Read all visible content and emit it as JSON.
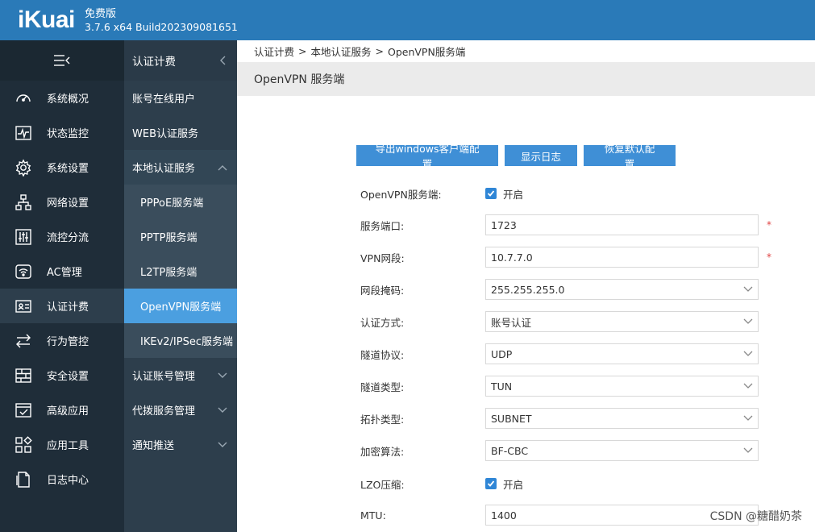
{
  "header": {
    "logo": "iKuai",
    "edition": "免费版",
    "build": "3.7.6 x64 Build202309081651"
  },
  "nav1": {
    "items": [
      {
        "label": "系统概况",
        "icon": "gauge-icon"
      },
      {
        "label": "状态监控",
        "icon": "monitor-icon"
      },
      {
        "label": "系统设置",
        "icon": "gear-icon"
      },
      {
        "label": "网络设置",
        "icon": "network-icon"
      },
      {
        "label": "流控分流",
        "icon": "sliders-icon"
      },
      {
        "label": "AC管理",
        "icon": "wifi-icon"
      },
      {
        "label": "认证计费",
        "icon": "id-card-icon"
      },
      {
        "label": "行为管控",
        "icon": "arrows-icon"
      },
      {
        "label": "安全设置",
        "icon": "firewall-icon"
      },
      {
        "label": "高级应用",
        "icon": "check-window-icon"
      },
      {
        "label": "应用工具",
        "icon": "tools-icon"
      },
      {
        "label": "日志中心",
        "icon": "document-icon"
      }
    ]
  },
  "nav2": {
    "title": "认证计费",
    "items": [
      "账号在线用户",
      "WEB认证服务",
      "本地认证服务"
    ],
    "sub": [
      "PPPoE服务端",
      "PPTP服务端",
      "L2TP服务端",
      "OpenVPN服务端",
      "IKEv2/IPSec服务端"
    ],
    "more": [
      "认证账号管理",
      "代拨服务管理",
      "通知推送"
    ]
  },
  "breadcrumb": {
    "a": "认证计费",
    "b": "本地认证服务",
    "c": "OpenVPN服务端",
    "sep": ">"
  },
  "page_title": "OpenVPN 服务端",
  "buttons": {
    "export": "导出windows客户端配置",
    "log": "显示日志",
    "reset": "恢复默认配置"
  },
  "form": {
    "enable_label": "OpenVPN服务端:",
    "enable_text": "开启",
    "port_label": "服务端口:",
    "port_value": "1723",
    "segment_label": "VPN网段:",
    "segment_value": "10.7.7.0",
    "mask_label": "网段掩码:",
    "mask_value": "255.255.255.0",
    "auth_label": "认证方式:",
    "auth_value": "账号认证",
    "proto_label": "隧道协议:",
    "proto_value": "UDP",
    "tunnel_label": "隧道类型:",
    "tunnel_value": "TUN",
    "topo_label": "拓扑类型:",
    "topo_value": "SUBNET",
    "cipher_label": "加密算法:",
    "cipher_value": "BF-CBC",
    "lzo_label": "LZO压缩:",
    "lzo_text": "开启",
    "mtu_label": "MTU:",
    "mtu_value": "1400",
    "required_mark": "*"
  },
  "watermark": "CSDN @糖醋奶茶",
  "colors": {
    "topbar": "#2a7ab8",
    "nav1": "#1f2d39",
    "nav2": "#2d3e4c",
    "active": "#4b9fe0",
    "button": "#3f8fd6"
  }
}
